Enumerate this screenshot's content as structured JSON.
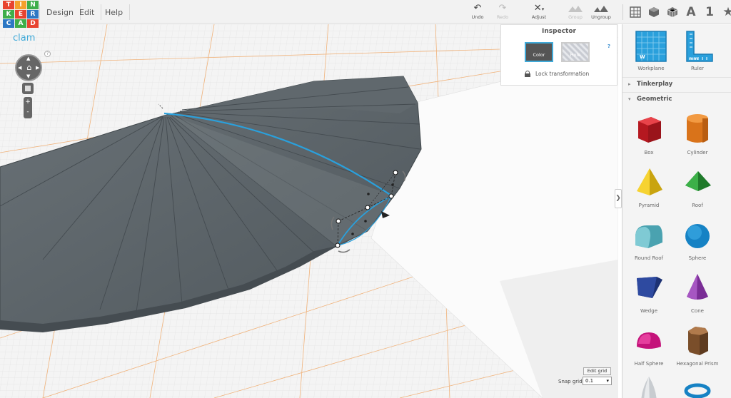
{
  "app": {
    "logo_letters": [
      "T",
      "I",
      "N",
      "K",
      "E",
      "R",
      "C",
      "A",
      "D"
    ],
    "logo_colors": [
      "#e8432f",
      "#f4a02b",
      "#3fae49",
      "#3fae49",
      "#e8432f",
      "#2d78c4",
      "#2d78c4",
      "#3fae49",
      "#e8432f"
    ]
  },
  "menu": {
    "design": "Design",
    "edit": "Edit",
    "help": "Help"
  },
  "toolbar": {
    "undo": "Undo",
    "redo": "Redo",
    "adjust": "Adjust",
    "group": "Group",
    "ungroup": "Ungroup"
  },
  "views": {
    "text_icon": "A",
    "number_icon": "1",
    "star_icon": "★"
  },
  "design": {
    "title": "clam"
  },
  "nav": {
    "help": "?",
    "zoom_in": "+",
    "zoom_out": "-"
  },
  "inspector": {
    "title": "Inspector",
    "help": "?",
    "color_label": "Color",
    "hole_label": "Hole",
    "lock_label": "Lock transformation"
  },
  "grid": {
    "edit_label": "Edit grid",
    "snap_label": "Snap grid",
    "snap_value": "0.1"
  },
  "panel": {
    "top_items": [
      {
        "label": "Workplane",
        "icon": "workplane-icon"
      },
      {
        "label": "Ruler",
        "icon": "ruler-icon"
      }
    ],
    "sections": {
      "tinkerplay": "Tinkerplay",
      "geometric": "Geometric"
    },
    "shapes": [
      {
        "label": "Box",
        "color": "#d4202a"
      },
      {
        "label": "Cylinder",
        "color": "#e8821e"
      },
      {
        "label": "Pyramid",
        "color": "#f2c81a"
      },
      {
        "label": "Roof",
        "color": "#2f9a3a"
      },
      {
        "label": "Round Roof",
        "color": "#5fb7c4"
      },
      {
        "label": "Sphere",
        "color": "#1b8fd0"
      },
      {
        "label": "Wedge",
        "color": "#233d8a"
      },
      {
        "label": "Cone",
        "color": "#8b3aa8"
      },
      {
        "label": "Half Sphere",
        "color": "#d91c8a"
      },
      {
        "label": "Hexagonal Prism",
        "color": "#8a5a32"
      }
    ]
  },
  "colors": {
    "accent": "#3fa9d8",
    "shape_gray": "#5f676c",
    "selection_blue": "#2aa0dc",
    "grid_orange": "#f0b27a"
  }
}
